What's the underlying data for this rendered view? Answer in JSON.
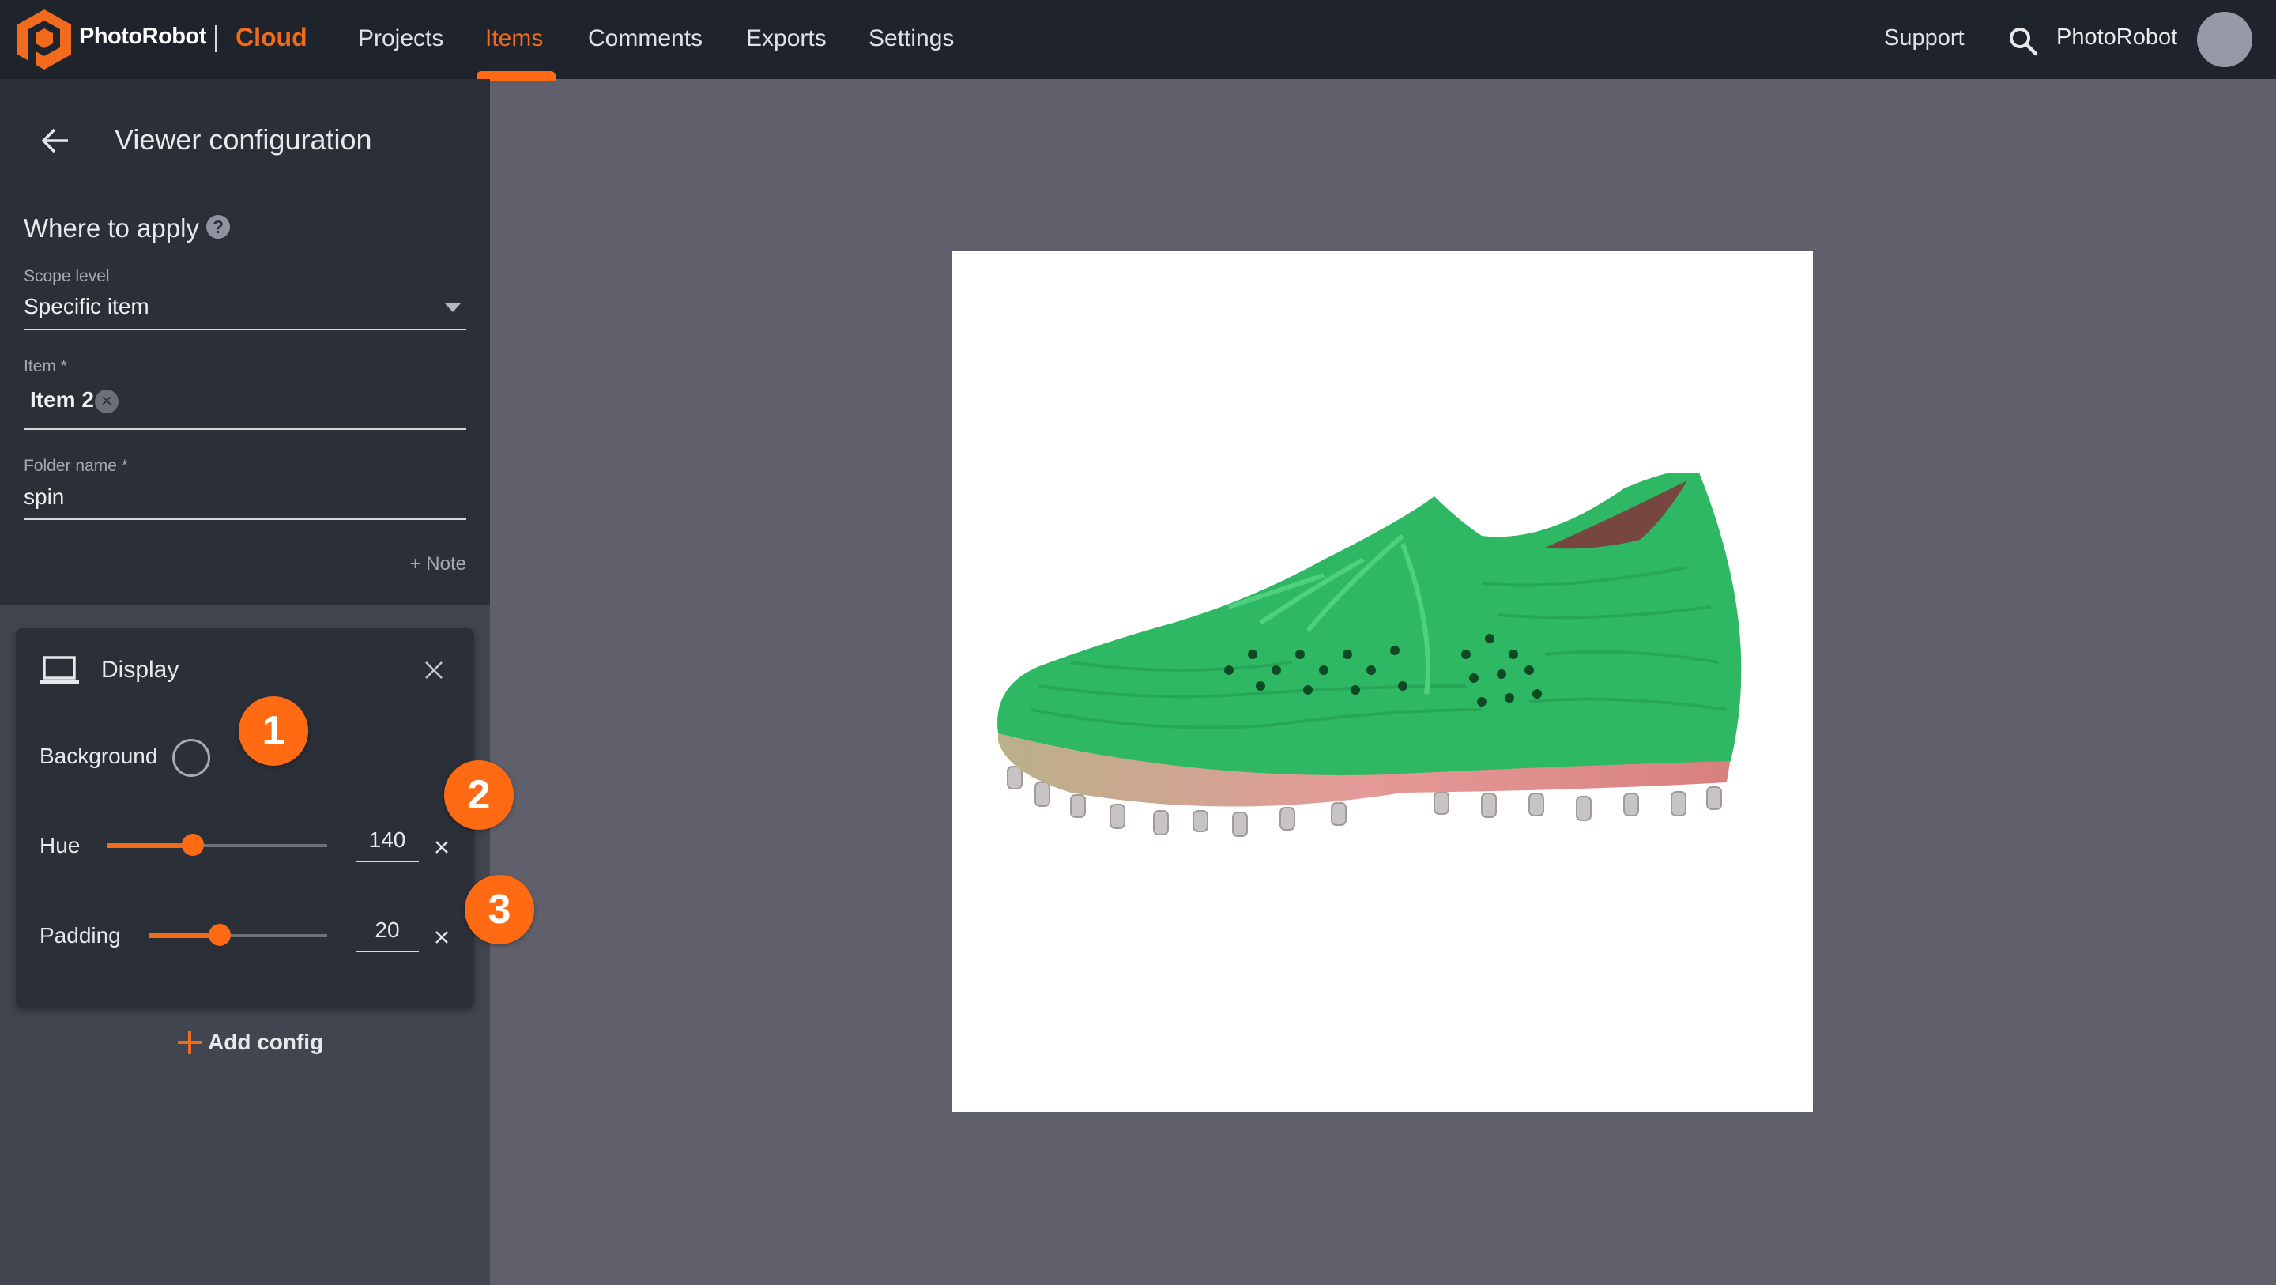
{
  "header": {
    "brand": "PhotoRobot",
    "product": "Cloud",
    "nav": [
      {
        "label": "Projects",
        "active": false
      },
      {
        "label": "Items",
        "active": true
      },
      {
        "label": "Comments",
        "active": false
      },
      {
        "label": "Exports",
        "active": false
      },
      {
        "label": "Settings",
        "active": false
      }
    ],
    "support_label": "Support",
    "user_name": "PhotoRobot",
    "icons": {
      "search": "search-icon",
      "avatar": "avatar"
    }
  },
  "colors": {
    "accent": "#f26a1b",
    "header_bg": "#1f232b",
    "panel_bg": "#2b2f37",
    "sidebar_bg": "#41454f",
    "canvas_bg": "#5f606b",
    "product_color": "#2fb864"
  },
  "panel": {
    "title": "Viewer configuration",
    "where_to_apply": {
      "title": "Where to apply",
      "scope_level": {
        "label": "Scope level",
        "value": "Specific item"
      },
      "item": {
        "label": "Item *",
        "chip": "Item 2"
      },
      "folder_name": {
        "label": "Folder name *",
        "value": "spin"
      },
      "note_link": "+ Note"
    },
    "display_card": {
      "title": "Display",
      "background": {
        "label": "Background"
      },
      "hue": {
        "label": "Hue",
        "value": "140",
        "min": 0,
        "max": 360
      },
      "padding": {
        "label": "Padding",
        "value": "20",
        "min": 0,
        "max": 50
      }
    },
    "add_config_label": "Add config"
  },
  "annotations": [
    {
      "number": "1",
      "target": "Background"
    },
    {
      "number": "2",
      "target": "Hue"
    },
    {
      "number": "3",
      "target": "Padding"
    }
  ],
  "preview": {
    "subject": "green football boot with cleats"
  }
}
